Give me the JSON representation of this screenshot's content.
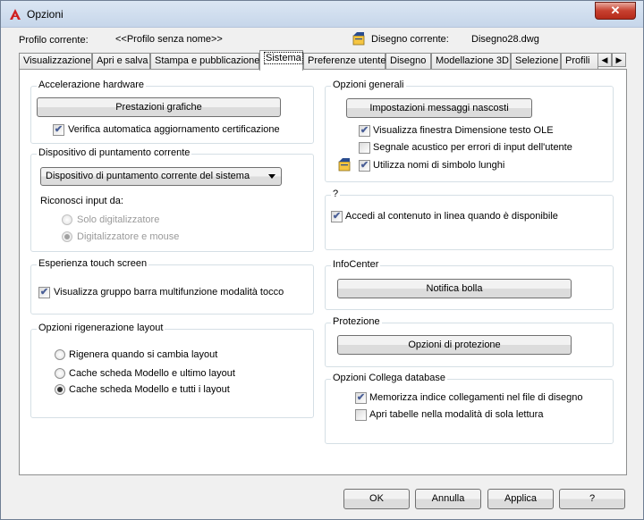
{
  "window": {
    "title": "Opzioni",
    "close_label": "✕"
  },
  "header": {
    "profile_label": "Profilo corrente:",
    "profile_value": "<<Profilo senza nome>>",
    "drawing_label": "Disegno corrente:",
    "drawing_value": "Disegno28.dwg"
  },
  "tabs": [
    {
      "label": "Visualizzazione"
    },
    {
      "label": "Apri e salva"
    },
    {
      "label": "Stampa e pubblicazione"
    },
    {
      "label": "Sistema",
      "active": true
    },
    {
      "label": "Preferenze utente"
    },
    {
      "label": "Disegno"
    },
    {
      "label": "Modellazione 3D"
    },
    {
      "label": "Selezione"
    },
    {
      "label": "Profili"
    }
  ],
  "left": {
    "hw": {
      "title": "Accelerazione hardware",
      "button": "Prestazioni grafiche",
      "check_label": "Verifica automatica aggiornamento certificazione",
      "checked": true
    },
    "pointing": {
      "title": "Dispositivo di puntamento corrente",
      "selected": "Dispositivo di puntamento corrente del sistema",
      "accept_label": "Riconosci input da:",
      "radio1": "Solo digitalizzatore",
      "radio2": "Digitalizzatore e mouse"
    },
    "touch": {
      "title": "Esperienza touch screen",
      "check_label": "Visualizza gruppo barra multifunzione modalità tocco",
      "checked": true
    },
    "regen": {
      "title": "Opzioni rigenerazione layout",
      "radio1": "Rigenera quando si cambia layout",
      "radio2": "Cache scheda Modello e ultimo layout",
      "radio3": "Cache scheda Modello e tutti i layout"
    }
  },
  "right": {
    "general": {
      "title": "Opzioni generali",
      "button": "Impostazioni messaggi nascosti",
      "check1": "Visualizza finestra Dimensione testo OLE",
      "check2": "Segnale acustico per errori di input dell'utente",
      "check3": "Utilizza nomi di simbolo lunghi"
    },
    "help": {
      "title": "?",
      "check_label": "Accedi al contenuto in linea quando è disponibile"
    },
    "infocenter": {
      "title": "InfoCenter",
      "button": "Notifica bolla"
    },
    "security": {
      "title": "Protezione",
      "button": "Opzioni di protezione"
    },
    "dblink": {
      "title": "Opzioni Collega database",
      "check1": "Memorizza indice collegamenti nel file di disegno",
      "check2": "Apri tabelle nella modalità di sola lettura"
    }
  },
  "footer": {
    "ok": "OK",
    "cancel": "Annulla",
    "apply": "Applica",
    "help": "?"
  },
  "colors": {
    "accent": "#4a5f97",
    "close": "#c7402f",
    "app_icon": "#d02020"
  }
}
